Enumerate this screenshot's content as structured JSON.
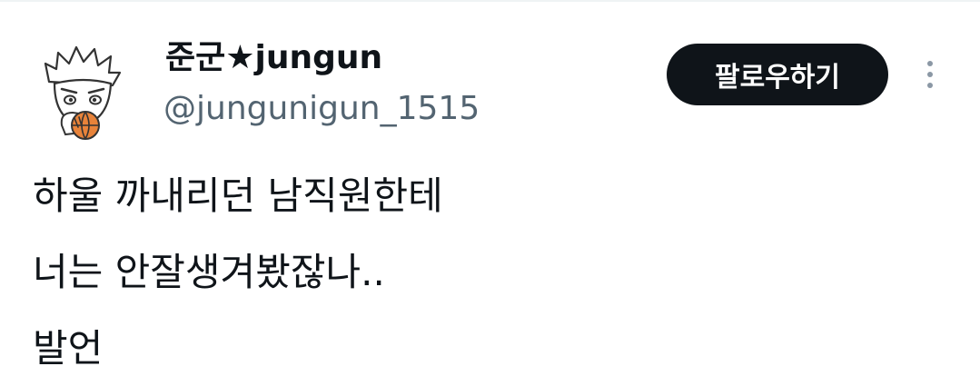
{
  "author": {
    "display_name": "준군★jungun",
    "handle": "@jungunigun_1515",
    "avatar_icon": "anime-character-avatar"
  },
  "actions": {
    "follow_label": "팔로우하기",
    "more_icon": "more-vertical-icon"
  },
  "tweet": {
    "lines": [
      "하울 까내리던 남직원한테",
      "너는 안잘생겨봤잖나..",
      "발언"
    ]
  },
  "colors": {
    "text_primary": "#0f1419",
    "text_secondary": "#536471",
    "button_bg": "#0f1419",
    "button_text": "#ffffff",
    "more_dots": "#8b98a5"
  }
}
